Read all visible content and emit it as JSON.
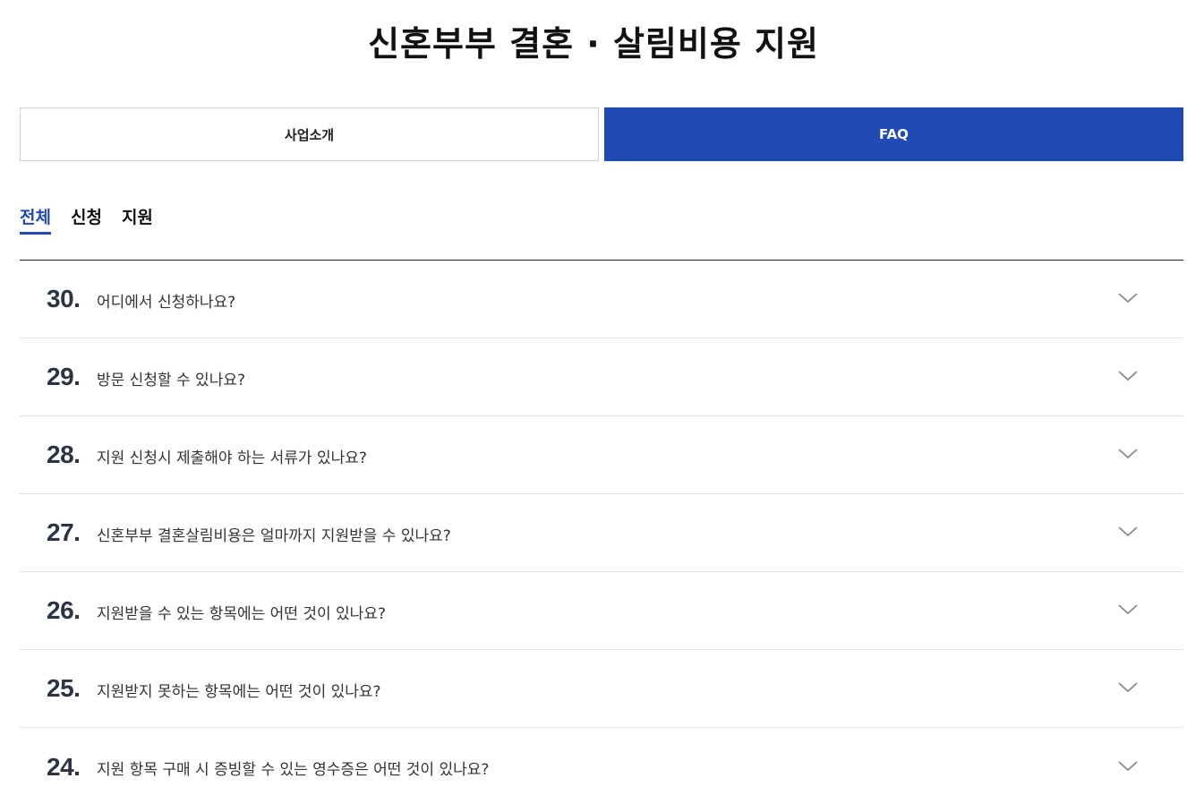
{
  "page": {
    "title": "신혼부부 결혼 · 살림비용 지원"
  },
  "tabs": [
    {
      "label": "사업소개",
      "active": false
    },
    {
      "label": "FAQ",
      "active": true
    }
  ],
  "filters": [
    {
      "label": "전체",
      "selected": true
    },
    {
      "label": "신청",
      "selected": false
    },
    {
      "label": "지원",
      "selected": false
    }
  ],
  "faq": [
    {
      "num": "30.",
      "question": "어디에서 신청하나요?"
    },
    {
      "num": "29.",
      "question": "방문 신청할 수 있나요?"
    },
    {
      "num": "28.",
      "question": "지원 신청시 제출해야 하는 서류가 있나요?"
    },
    {
      "num": "27.",
      "question": "신혼부부 결혼살림비용은 얼마까지 지원받을 수 있나요?"
    },
    {
      "num": "26.",
      "question": "지원받을 수 있는 항목에는 어떤 것이 있나요?"
    },
    {
      "num": "25.",
      "question": "지원받지 못하는 항목에는 어떤 것이 있나요?"
    },
    {
      "num": "24.",
      "question": "지원 항목 구매 시 증빙할 수 있는 영수증은 어떤 것이 있나요?"
    }
  ],
  "colors": {
    "accent": "#214bb4",
    "chevron": "#8a8a8a"
  },
  "icons": {
    "expand": "chevron-down-icon"
  }
}
